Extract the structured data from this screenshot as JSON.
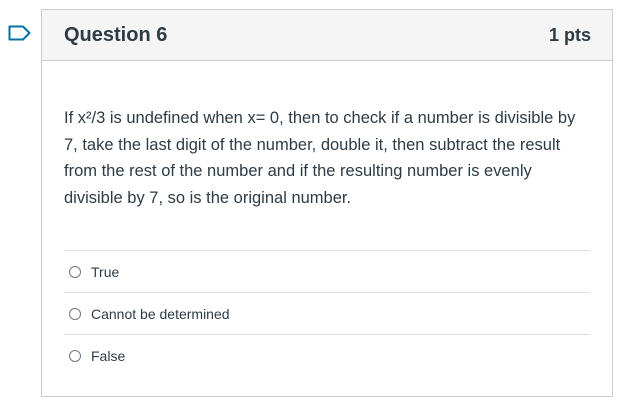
{
  "question": {
    "title": "Question 6",
    "points": "1 pts",
    "text": "If x²/3 is undefined when x= 0, then to check if a number is divisible by 7, take the last digit of the number, double it, then subtract the result from the rest of the number and if the resulting number is evenly divisible by 7, so is the original number.",
    "flag_icon": "bookmark-flag-icon",
    "flag_color": "#0770a3"
  },
  "answers": [
    {
      "label": "True"
    },
    {
      "label": "Cannot be determined"
    },
    {
      "label": "False"
    }
  ]
}
